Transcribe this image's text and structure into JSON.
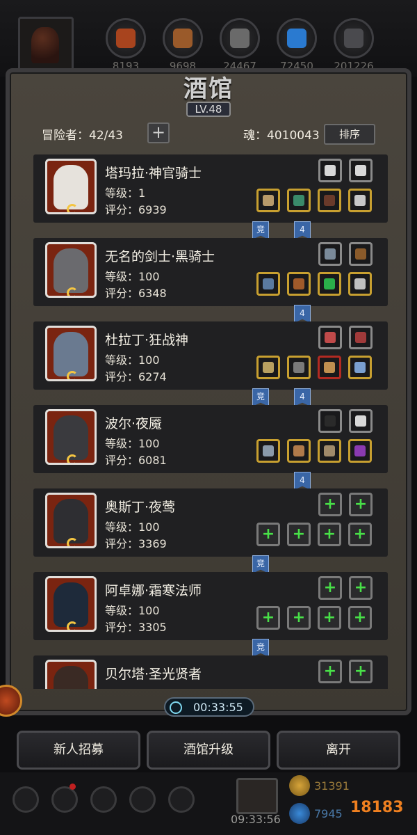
{
  "resources": [
    {
      "icon": "leather-icon",
      "value": "8193",
      "color": "#a8441e"
    },
    {
      "icon": "wood-icon",
      "value": "9698",
      "color": "#9a5a2a"
    },
    {
      "icon": "iron-icon",
      "value": "24467",
      "color": "#6a6a6a"
    },
    {
      "icon": "crystal-icon",
      "value": "72450",
      "color": "#2a7ad0"
    },
    {
      "icon": "ore-icon",
      "value": "201226",
      "color": "#4a4a4e"
    }
  ],
  "header": {
    "title": "酒馆",
    "level": "LV.48",
    "adventurers": "冒险者：42/43",
    "add_label": "+",
    "soul": "魂：4010043",
    "sort_label": "排序"
  },
  "heroes": [
    {
      "name": "塔玛拉·神官骑士",
      "level": "等级：1",
      "score": "评分：6939",
      "top_slots": [
        {
          "k": "white",
          "c": "#d8d8d8"
        },
        {
          "k": "white",
          "c": "#d8d8d8"
        }
      ],
      "bottom_slots": [
        {
          "k": "gold",
          "c": "#b89a6a"
        },
        {
          "k": "gold",
          "c": "#3a8a6a"
        },
        {
          "k": "gold",
          "c": "#6a3a2a"
        },
        {
          "k": "gold",
          "c": "#c8c8c8"
        }
      ],
      "tags": [
        "竞",
        "4"
      ],
      "face": "#e6e2dc"
    },
    {
      "name": "无名的剑士·黑骑士",
      "level": "等级：100",
      "score": "评分：6348",
      "top_slots": [
        {
          "k": "white",
          "c": "#7a8a9a"
        },
        {
          "k": "white",
          "c": "#8a5a2a"
        }
      ],
      "bottom_slots": [
        {
          "k": "gold",
          "c": "#5a7aa0"
        },
        {
          "k": "gold",
          "c": "#a05a2a"
        },
        {
          "k": "gold",
          "c": "#2ab04a"
        },
        {
          "k": "gold",
          "c": "#c0c0c0"
        }
      ],
      "tags": [
        "4"
      ],
      "face": "#6a6a6e"
    },
    {
      "name": "杜拉丁·狂战神",
      "level": "等级：100",
      "score": "评分：6274",
      "top_slots": [
        {
          "k": "white",
          "c": "#c04a4a"
        },
        {
          "k": "white",
          "c": "#a03a3a"
        }
      ],
      "bottom_slots": [
        {
          "k": "gold",
          "c": "#b8a060"
        },
        {
          "k": "gold",
          "c": "#7a7a7a"
        },
        {
          "k": "red",
          "c": "#c09050"
        },
        {
          "k": "gold",
          "c": "#7aa0d0"
        }
      ],
      "tags": [
        "竞",
        "4"
      ],
      "face": "#6a7a90"
    },
    {
      "name": "波尔·夜魇",
      "level": "等级：100",
      "score": "评分：6081",
      "top_slots": [
        {
          "k": "white",
          "c": "#2a2a2a"
        },
        {
          "k": "white",
          "c": "#d8d8d8"
        }
      ],
      "bottom_slots": [
        {
          "k": "gold",
          "c": "#8a9aaa"
        },
        {
          "k": "gold",
          "c": "#b07a4a"
        },
        {
          "k": "gold",
          "c": "#a08a6a"
        },
        {
          "k": "gold",
          "c": "#8a3ab0"
        }
      ],
      "tags": [
        "4"
      ],
      "face": "#3a3a3e"
    },
    {
      "name": "奥斯丁·夜莺",
      "level": "等级：100",
      "score": "评分：3369",
      "top_slots": [
        {
          "k": "empty"
        },
        {
          "k": "empty"
        }
      ],
      "bottom_slots": [
        {
          "k": "empty"
        },
        {
          "k": "empty"
        },
        {
          "k": "empty"
        },
        {
          "k": "empty"
        }
      ],
      "tags": [
        "竞"
      ],
      "face": "#2e2e32"
    },
    {
      "name": "阿卓娜·霜寒法师",
      "level": "等级：100",
      "score": "评分：3305",
      "top_slots": [
        {
          "k": "empty"
        },
        {
          "k": "empty"
        }
      ],
      "bottom_slots": [
        {
          "k": "empty"
        },
        {
          "k": "empty"
        },
        {
          "k": "empty"
        },
        {
          "k": "empty"
        }
      ],
      "tags": [
        "竞"
      ],
      "face": "#1e2a3a"
    },
    {
      "name": "贝尔塔·圣光贤者",
      "level": "",
      "score": "",
      "top_slots": [
        {
          "k": "empty"
        },
        {
          "k": "empty"
        }
      ],
      "bottom_slots": [],
      "tags": [],
      "face": "#3a2a24"
    }
  ],
  "timer": "00:33:55",
  "buttons": {
    "recruit": "新人招募",
    "upgrade": "酒馆升级",
    "leave": "离开"
  },
  "bottom": {
    "chest_timer": "09:33:56",
    "coins": "31391",
    "gems": "7945",
    "logo": "18183"
  }
}
